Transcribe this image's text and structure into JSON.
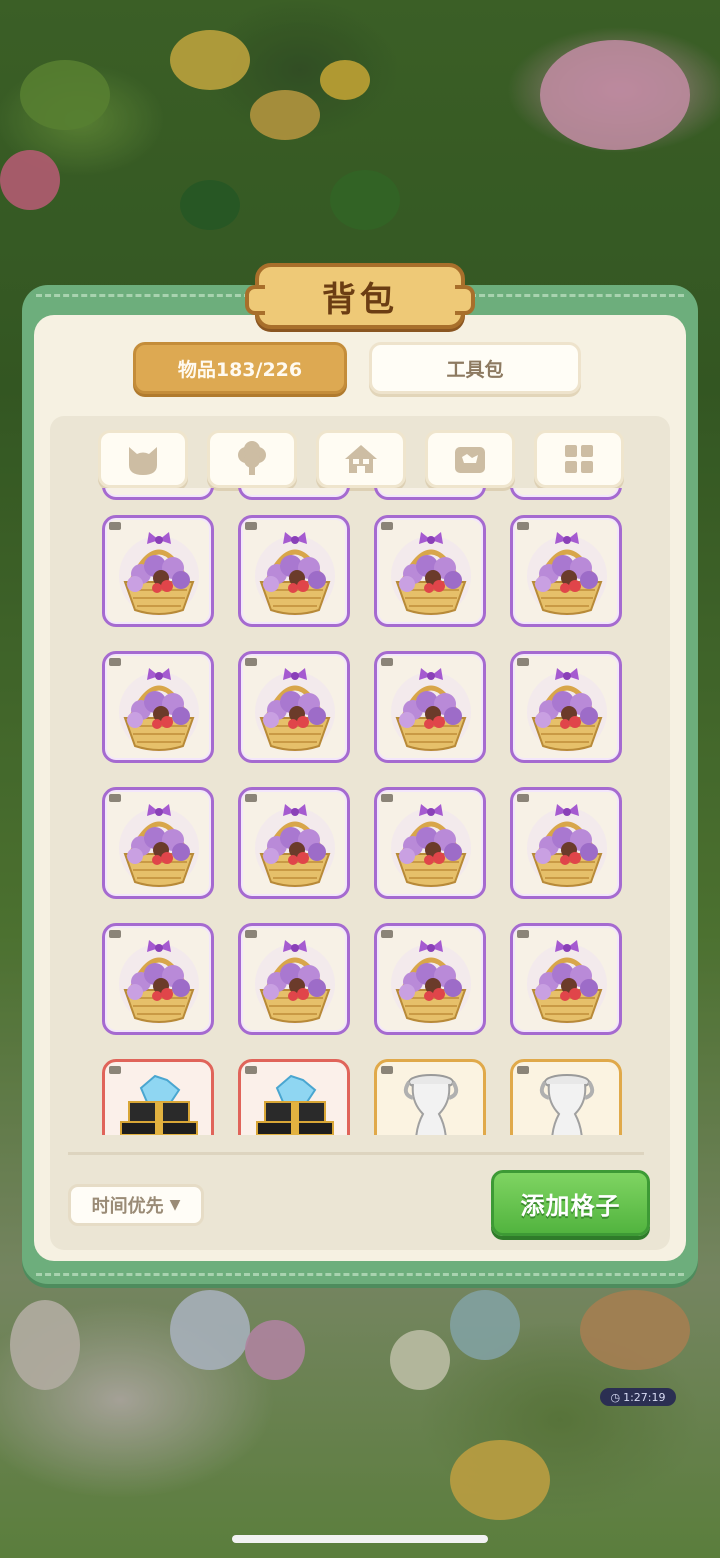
{
  "title": "背包",
  "tabs": [
    {
      "label": "物品183/226",
      "active": true
    },
    {
      "label": "工具包",
      "active": false
    }
  ],
  "categories": [
    {
      "icon": "cat-face-icon"
    },
    {
      "icon": "tree-icon"
    },
    {
      "icon": "house-icon"
    },
    {
      "icon": "treasure-chest-icon"
    },
    {
      "icon": "grid-icon"
    }
  ],
  "items": [
    "flower-basket",
    "flower-basket",
    "flower-basket",
    "flower-basket",
    "flower-basket",
    "flower-basket",
    "flower-basket",
    "flower-basket",
    "flower-basket",
    "flower-basket",
    "flower-basket",
    "flower-basket",
    "flower-basket",
    "flower-basket",
    "flower-basket",
    "flower-basket",
    "gift-box-crystals",
    "gift-box-crystals",
    "white-vase",
    "white-vase"
  ],
  "sort_label": "时间优先",
  "add_slot_label": "添加格子",
  "timer": "1:27:19",
  "colors": {
    "panel_green": "#6dae7c",
    "tab_active": "#dda952",
    "add_button": "#52b43f",
    "rarity_purple": "#a56ad0"
  }
}
